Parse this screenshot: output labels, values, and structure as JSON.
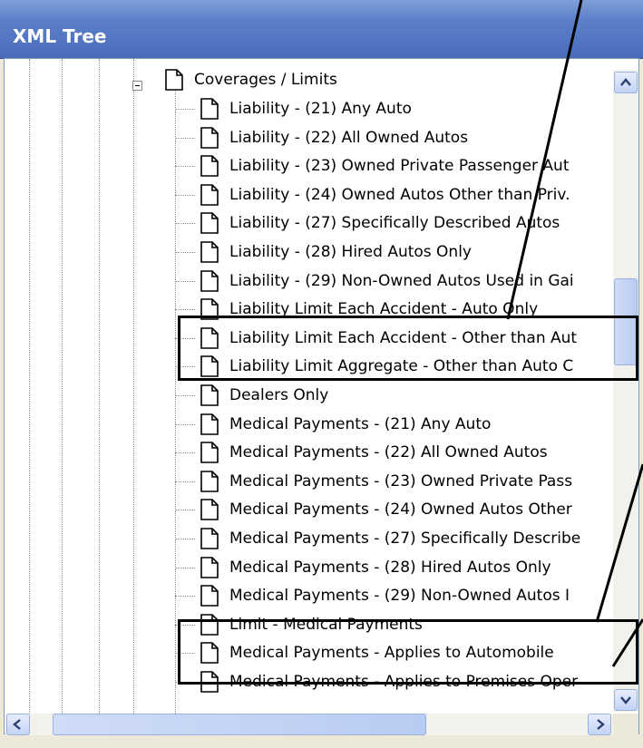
{
  "window": {
    "title": "XML Tree"
  },
  "tree": {
    "root": {
      "label": "Coverages / Limits",
      "expanded": true
    },
    "items": [
      {
        "label": "Liability - (21) Any Auto"
      },
      {
        "label": "Liability - (22) All Owned Autos"
      },
      {
        "label": "Liability - (23) Owned Private Passenger Aut"
      },
      {
        "label": "Liability - (24) Owned Autos Other than Priv."
      },
      {
        "label": "Liability - (27) Specifically Described Autos"
      },
      {
        "label": "Liability - (28) Hired Autos Only"
      },
      {
        "label": "Liability - (29) Non-Owned Autos Used in Gai"
      },
      {
        "label": "Liability Limit Each Accident - Auto Only"
      },
      {
        "label": "Liability Limit Each Accident - Other than Aut"
      },
      {
        "label": "Liability Limit Aggregate - Other than Auto C"
      },
      {
        "label": "Dealers Only"
      },
      {
        "label": "Medical Payments - (21) Any Auto"
      },
      {
        "label": "Medical Payments - (22) All Owned Autos"
      },
      {
        "label": "Medical Payments - (23) Owned Private Pass"
      },
      {
        "label": "Medical Payments - (24) Owned Autos Other"
      },
      {
        "label": "Medical Payments - (27) Specifically Describe"
      },
      {
        "label": "Medical Payments - (28) Hired Autos Only"
      },
      {
        "label": "Medical Payments - (29) Non-Owned Autos I"
      },
      {
        "label": "Limit - Medical Payments"
      },
      {
        "label": "Medical Payments - Applies to Automobile"
      },
      {
        "label": "Medical Payments - Applies to Premises Oper"
      }
    ]
  },
  "scrollbars": {
    "vertical": {
      "position": 0.42
    },
    "horizontal": {
      "position": 0.12
    }
  },
  "icons": {
    "node": "document-icon",
    "expander": "collapse-minus-icon"
  }
}
